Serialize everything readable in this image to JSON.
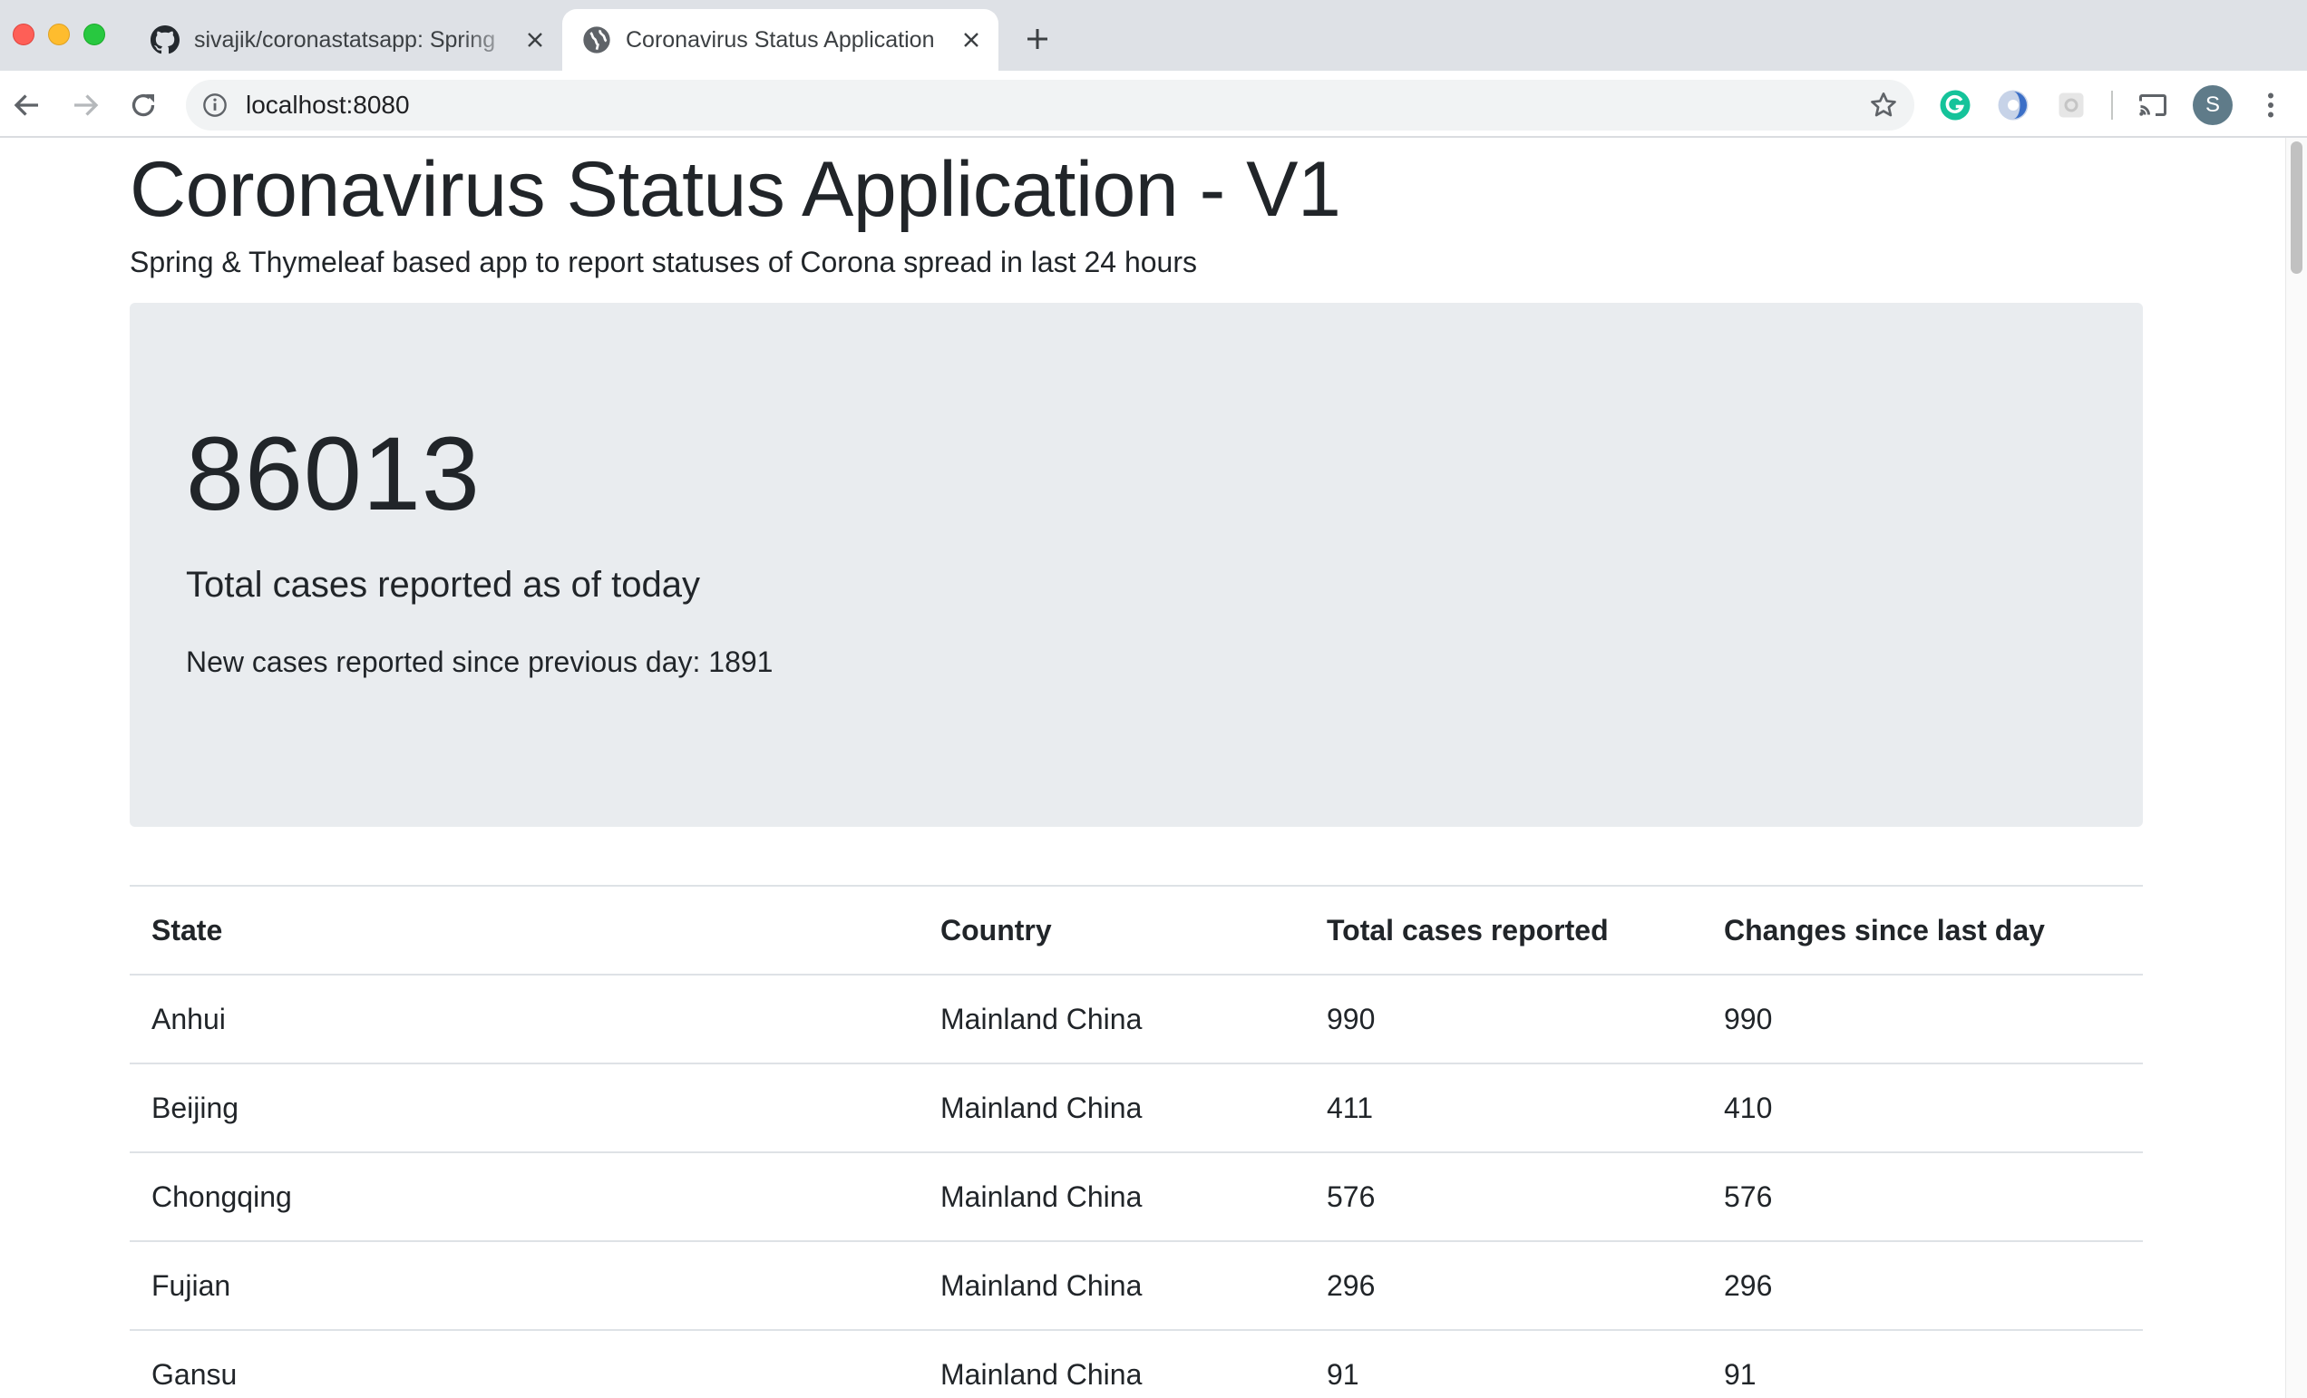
{
  "browser": {
    "tabs": [
      {
        "title": "sivajik/coronastatsapp: Spring",
        "favicon": "github-icon",
        "active": false
      },
      {
        "title": "Coronavirus Status Application",
        "favicon": "globe-icon",
        "active": true
      }
    ],
    "url": "localhost:8080",
    "profile_initial": "S"
  },
  "page": {
    "title": "Coronavirus Status Application - V1",
    "subtitle": "Spring & Thymeleaf based app to report statuses of Corona spread in last 24 hours",
    "total_cases": "86013",
    "total_label": "Total cases reported as of today",
    "new_cases_text": "New cases reported since previous day: 1891"
  },
  "table": {
    "headers": [
      "State",
      "Country",
      "Total cases reported",
      "Changes since last day"
    ],
    "rows": [
      {
        "state": "Anhui",
        "country": "Mainland China",
        "total": "990",
        "change": "990"
      },
      {
        "state": "Beijing",
        "country": "Mainland China",
        "total": "411",
        "change": "410"
      },
      {
        "state": "Chongqing",
        "country": "Mainland China",
        "total": "576",
        "change": "576"
      },
      {
        "state": "Fujian",
        "country": "Mainland China",
        "total": "296",
        "change": "296"
      },
      {
        "state": "Gansu",
        "country": "Mainland China",
        "total": "91",
        "change": "91"
      }
    ]
  },
  "colors": {
    "jumbotron_bg": "#e9ecef",
    "text": "#212529",
    "grammarly": "#15c39a"
  }
}
